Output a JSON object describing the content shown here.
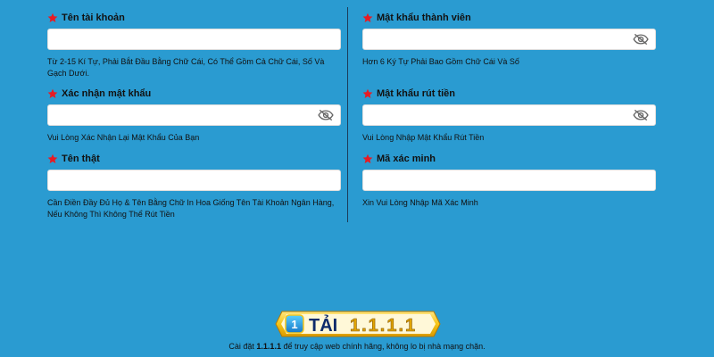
{
  "fields": [
    {
      "id": "username",
      "label": "Tên tài khoản",
      "value": "",
      "hint": "Từ 2-15 Kí Tự, Phải Bắt Đầu Bằng Chữ Cái, Có Thể Gồm Cả Chữ Cái, Số Và Gạch Dưới.",
      "has_eye": false
    },
    {
      "id": "member_password",
      "label": "Mật khẩu thành viên",
      "value": "",
      "hint": "Hơn 6 Ký Tự Phải Bao Gồm Chữ Cái Và Số",
      "has_eye": true
    },
    {
      "id": "confirm_password",
      "label": "Xác nhận mật khẩu",
      "value": "",
      "hint": "Vui Lòng Xác Nhận Lại Mật Khẩu Của Bạn",
      "has_eye": true
    },
    {
      "id": "withdraw_password",
      "label": "Mật khẩu rút tiền",
      "value": "",
      "hint": "Vui Lòng Nhập Mật Khẩu Rút Tiền",
      "has_eye": true
    },
    {
      "id": "real_name",
      "label": "Tên thật",
      "value": "",
      "hint": "Cần Điền Đầy Đủ Họ & Tên Bằng Chữ In Hoa Giống Tên Tài Khoản Ngân Hàng, Nếu Không Thì Không Thể Rút Tiền",
      "has_eye": false
    },
    {
      "id": "verify_code",
      "label": "Mã xác minh",
      "value": "",
      "hint": "Xin Vui Lòng Nhập Mã Xác Minh",
      "has_eye": false
    }
  ],
  "banner": {
    "prefix": "TẢI",
    "number": "1.1.1.1",
    "badge": "1"
  },
  "footer": {
    "before": "Cài đặt ",
    "bold": "1.1.1.1",
    "after": " để truy cập web chính hãng, không lo bị nhà mạng chặn."
  },
  "colors": {
    "background": "#2a9bd1",
    "star": "#e81b23",
    "banner_gold": "#f5c518"
  }
}
